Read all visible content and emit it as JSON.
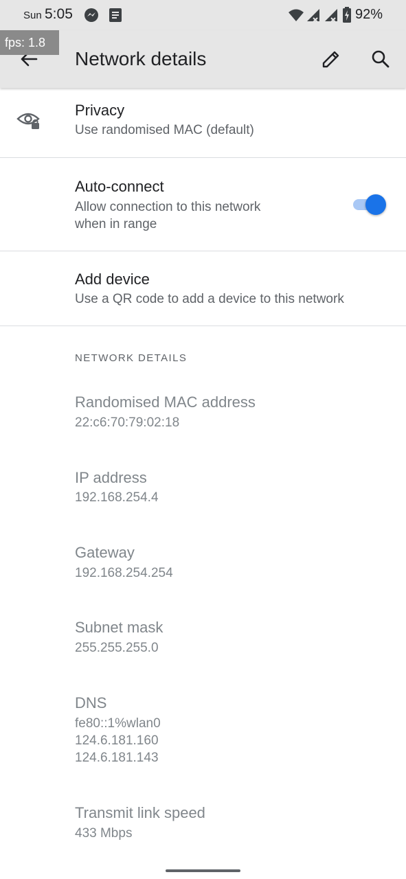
{
  "status_bar": {
    "day": "Sun",
    "time": "5:05",
    "battery_percent": "92%",
    "icons": [
      "messenger-icon",
      "notes-icon",
      "wifi-icon",
      "signal-icon",
      "signal-icon",
      "battery-icon"
    ]
  },
  "debug": {
    "fps_label": "fps: 1.8"
  },
  "app_bar": {
    "title": "Network details",
    "icons": [
      "back-arrow-icon",
      "edit-pencil-icon",
      "search-icon"
    ]
  },
  "privacy": {
    "title": "Privacy",
    "subtitle": "Use randomised MAC (default)",
    "icon": "eye-lock-icon"
  },
  "auto_connect": {
    "title": "Auto-connect",
    "subtitle_line1": "Allow connection to this network",
    "subtitle_line2": "when in range",
    "enabled": true
  },
  "add_device": {
    "title": "Add device",
    "subtitle": "Use a QR code to add a device to this network"
  },
  "network_details": {
    "header": "NETWORK DETAILS",
    "items": [
      {
        "label": "Randomised MAC address",
        "values": [
          "22:c6:70:79:02:18"
        ]
      },
      {
        "label": "IP address",
        "values": [
          "192.168.254.4"
        ]
      },
      {
        "label": "Gateway",
        "values": [
          "192.168.254.254"
        ]
      },
      {
        "label": "Subnet mask",
        "values": [
          "255.255.255.0"
        ]
      },
      {
        "label": "DNS",
        "values": [
          "fe80::1%wlan0",
          "124.6.181.160",
          "124.6.181.143"
        ]
      },
      {
        "label": "Transmit link speed",
        "values": [
          "433 Mbps"
        ]
      }
    ]
  },
  "colors": {
    "accent": "#1a73e8",
    "app_bar_bg": "#e6e6e6",
    "divider": "#dadce0"
  }
}
